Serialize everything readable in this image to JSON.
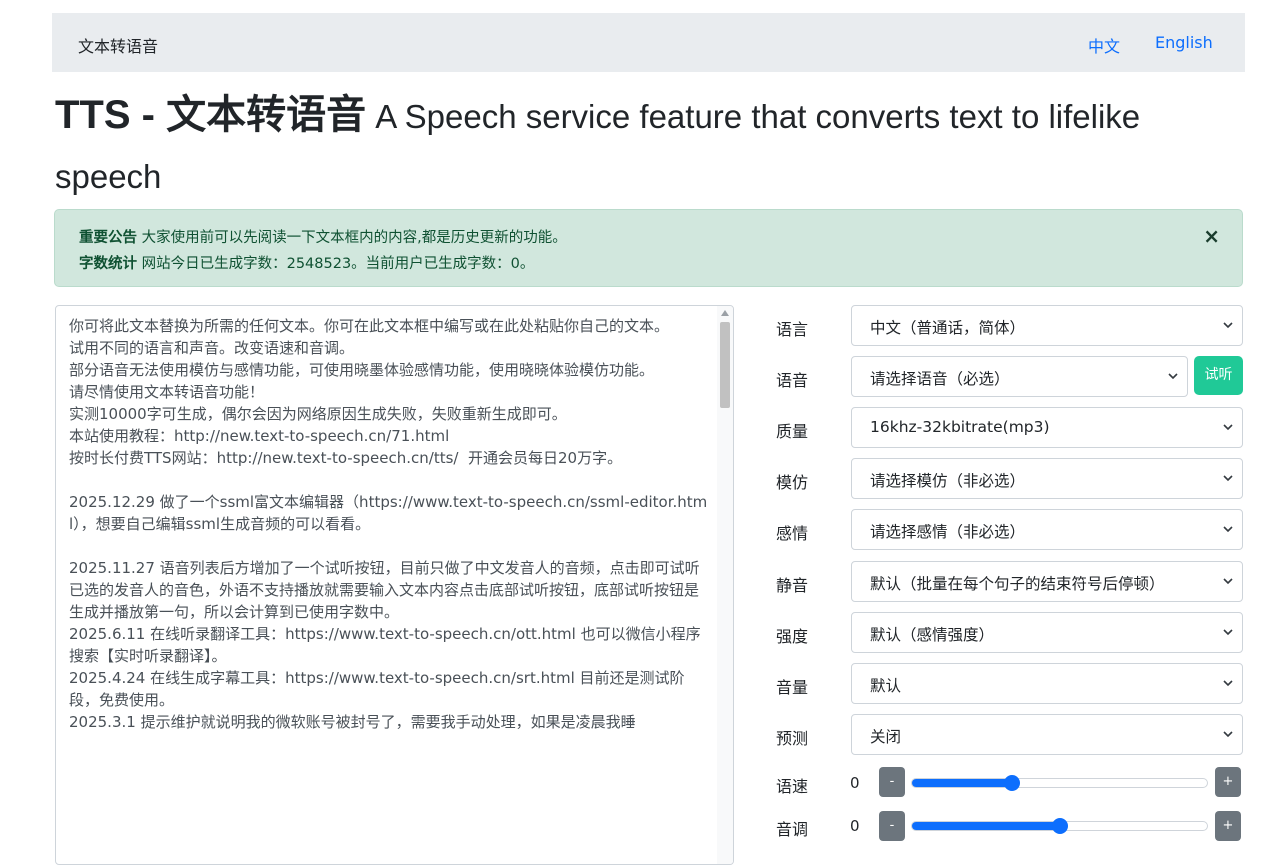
{
  "navbar": {
    "brand": "文本转语音",
    "links": [
      "中文",
      "English"
    ]
  },
  "heading": {
    "main": "TTS - 文本转语音",
    "sub": " A Speech service feature that converts text to lifelike speech"
  },
  "alert": {
    "line1_bold": "重要公告",
    "line1_text": " 大家使用前可以先阅读一下文本框内的内容,都是历史更新的功能。",
    "line2_bold": "字数统计",
    "line2_text": " 网站今日已生成字数：2548523。当前用户已生成字数：0。",
    "close": "×"
  },
  "textarea": {
    "content": "你可将此文本替换为所需的任何文本。你可在此文本框中编写或在此处粘贴你自己的文本。\n试用不同的语言和声音。改变语速和音调。\n部分语音无法使用模仿与感情功能，可使用晓墨体验感情功能，使用晓晓体验模仿功能。\n请尽情使用文本转语音功能！\n实测10000字可生成，偶尔会因为网络原因生成失败，失败重新生成即可。\n本站使用教程：http://new.text-to-speech.cn/71.html\n按时长付费TTS网站：http://new.text-to-speech.cn/tts/  开通会员每日20万字。\n\n2025.12.29 做了一个ssml富文本编辑器（https://www.text-to-speech.cn/ssml-editor.html），想要自己编辑ssml生成音频的可以看看。\n\n2025.11.27 语音列表后方增加了一个试听按钮，目前只做了中文发音人的音频，点击即可试听已选的发音人的音色，外语不支持播放就需要输入文本内容点击底部试听按钮，底部试听按钮是生成并播放第一句，所以会计算到已使用字数中。\n2025.6.11 在线听录翻译工具：https://www.text-to-speech.cn/ott.html 也可以微信小程序搜索【实时听录翻译】。\n2025.4.24 在线生成字幕工具：https://www.text-to-speech.cn/srt.html 目前还是测试阶段，免费使用。\n2025.3.1 提示维护就说明我的微软账号被封号了，需要我手动处理，如果是凌晨我睡"
  },
  "form": {
    "language": {
      "label": "语言",
      "value": "中文（普通话，简体）"
    },
    "voice": {
      "label": "语音",
      "value": "请选择语音（必选）",
      "listen_button": "试听"
    },
    "quality": {
      "label": "质量",
      "value": "16khz-32kbitrate(mp3)"
    },
    "imitate": {
      "label": "模仿",
      "value": "请选择模仿（非必选）"
    },
    "emotion": {
      "label": "感情",
      "value": "请选择感情（非必选）"
    },
    "silence": {
      "label": "静音",
      "value": "默认（批量在每个句子的结束符号后停顿）"
    },
    "intensity": {
      "label": "强度",
      "value": "默认（感情强度）"
    },
    "volume": {
      "label": "音量",
      "value": "默认"
    },
    "predict": {
      "label": "预测",
      "value": "关闭"
    },
    "rate": {
      "label": "语速",
      "value": "0",
      "minus": "-",
      "plus": "+",
      "level": 0.34
    },
    "pitch": {
      "label": "音调",
      "value": "0",
      "minus": "-",
      "plus": "+",
      "level": 0.5
    }
  }
}
